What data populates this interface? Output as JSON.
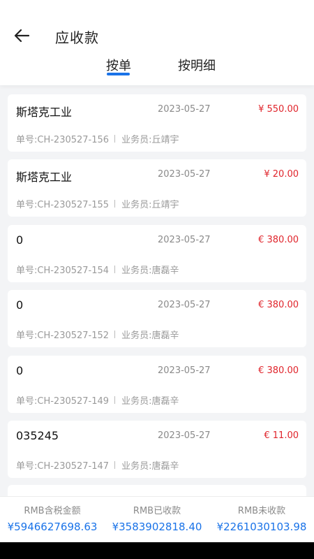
{
  "header": {
    "title": "应收款",
    "tabs": [
      {
        "label": "按单",
        "active": true
      },
      {
        "label": "按明细",
        "active": false
      }
    ]
  },
  "colors": {
    "accent": "#1a73e8",
    "amount": "#e0242b"
  },
  "orders": [
    {
      "name": "斯塔克工业",
      "date": "2023-05-27",
      "amount": "¥ 550.00",
      "order_no": "单号:CH-230527-156",
      "salesperson": "业务员:丘靖宇"
    },
    {
      "name": "斯塔克工业",
      "date": "2023-05-27",
      "amount": "¥ 20.00",
      "order_no": "单号:CH-230527-155",
      "salesperson": "业务员:丘靖宇"
    },
    {
      "name": "0",
      "date": "2023-05-27",
      "amount": "€ 380.00",
      "order_no": "单号:CH-230527-154",
      "salesperson": "业务员:唐磊辛"
    },
    {
      "name": "0",
      "date": "2023-05-27",
      "amount": "€ 380.00",
      "order_no": "单号:CH-230527-152",
      "salesperson": "业务员:唐磊辛"
    },
    {
      "name": "0",
      "date": "2023-05-27",
      "amount": "€ 380.00",
      "order_no": "单号:CH-230527-149",
      "salesperson": "业务员:唐磊辛"
    },
    {
      "name": "035245",
      "date": "2023-05-27",
      "amount": "€ 11.00",
      "order_no": "单号:CH-230527-147",
      "salesperson": "业务员:唐磊辛"
    }
  ],
  "summary": [
    {
      "label": "RMB含税金额",
      "value": "¥5946627698.63"
    },
    {
      "label": "RMB已收款",
      "value": "¥3583902818.40"
    },
    {
      "label": "RMB未收款",
      "value": "¥2261030103.98"
    }
  ]
}
